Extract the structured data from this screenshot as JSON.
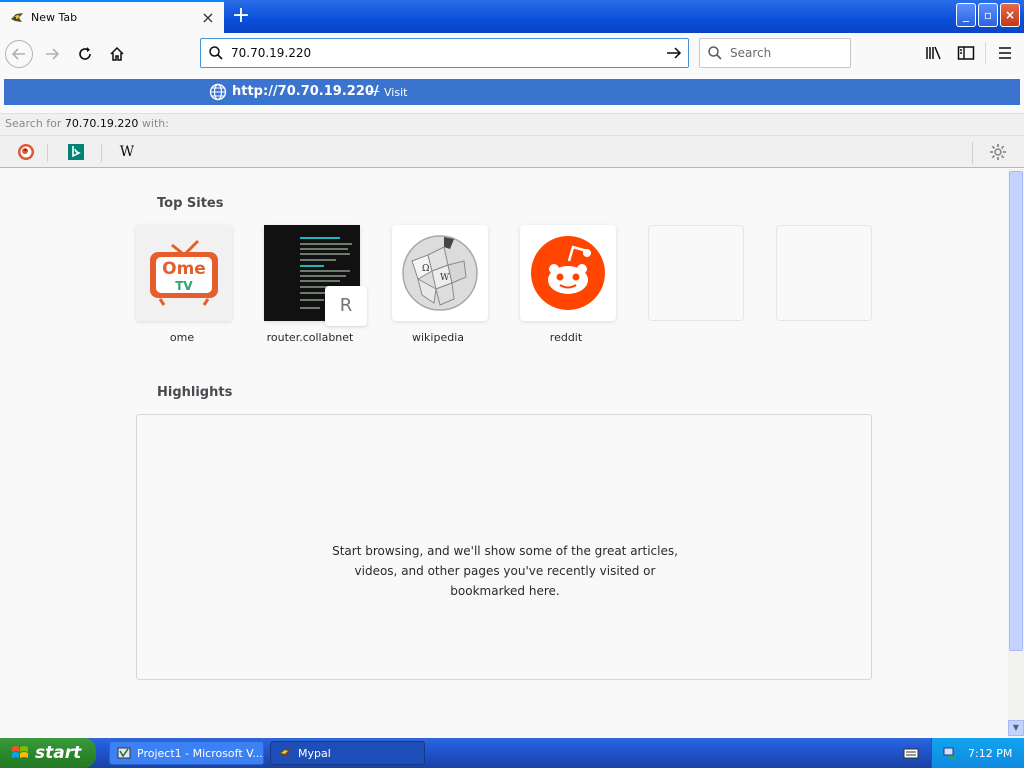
{
  "browser": {
    "tab": {
      "title": "New Tab",
      "close_glyph": "×"
    },
    "new_tab_glyph": "+",
    "window_controls": {
      "minimize": "_",
      "maximize": "▫",
      "close": "×"
    },
    "url_input": {
      "value": "70.70.19.220"
    },
    "search_input": {
      "placeholder": "Search"
    },
    "url_popup": {
      "url": "http://70.70.19.220/",
      "separator": "—",
      "action": "Visit"
    },
    "search_for": {
      "prefix": "Search for",
      "query": "70.70.19.220",
      "suffix": "with:"
    },
    "search_engines": [
      "duckduckgo-icon",
      "bing-icon",
      "wikipedia-icon"
    ],
    "wiki_glyph": "W"
  },
  "page": {
    "top_sites_title": "Top Sites",
    "top_sites": [
      {
        "label": "ome",
        "logo_text": "Ome",
        "logo_sub": "TV"
      },
      {
        "label": "router.collabnet",
        "badge": "R"
      },
      {
        "label": "wikipedia"
      },
      {
        "label": "reddit"
      },
      {
        "label": ""
      },
      {
        "label": ""
      }
    ],
    "highlights_title": "Highlights",
    "highlights_empty": [
      "Start browsing, and we'll show some of the great articles,",
      "videos, and other pages you've recently visited or",
      "bookmarked here."
    ]
  },
  "taskbar": {
    "start_label": "start",
    "tasks": [
      {
        "label": "Project1 - Microsoft V..."
      },
      {
        "label": "Mypal"
      }
    ],
    "clock": "7:12 PM"
  },
  "colors": {
    "accent": "#0a84ff",
    "popup_row": "#3b74cf",
    "reddit": "#ff4500",
    "ome": "#e45f2b",
    "ome_tv": "#2aa86a"
  }
}
